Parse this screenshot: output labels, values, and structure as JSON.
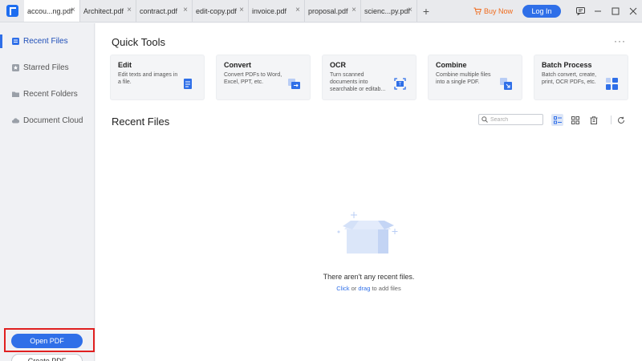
{
  "tabs": [
    {
      "label": "accou...ng.pdf",
      "active": true
    },
    {
      "label": "Architect.pdf"
    },
    {
      "label": "contract.pdf"
    },
    {
      "label": "edit-copy.pdf"
    },
    {
      "label": "invoice.pdf"
    },
    {
      "label": "proposal.pdf"
    },
    {
      "label": "scienc...py.pdf"
    }
  ],
  "tab_add": "+",
  "tab_close": "×",
  "header": {
    "buy_now": "Buy Now",
    "login": "Log In"
  },
  "sidebar": {
    "items": [
      {
        "label": "Recent Files",
        "icon": "recent-files-icon",
        "active": true
      },
      {
        "label": "Starred Files",
        "icon": "star-icon"
      },
      {
        "label": "Recent Folders",
        "icon": "folder-icon"
      },
      {
        "label": "Document Cloud",
        "icon": "cloud-icon"
      }
    ],
    "open_pdf": "Open PDF",
    "create_pdf": "Create PDF"
  },
  "main": {
    "quick_tools_title": "Quick Tools",
    "more": "···",
    "tools": [
      {
        "name": "Edit",
        "desc": "Edit texts and images in a file.",
        "icon": "edit-icon"
      },
      {
        "name": "Convert",
        "desc": "Convert PDFs to Word, Excel, PPT, etc.",
        "icon": "convert-icon"
      },
      {
        "name": "OCR",
        "desc": "Turn scanned documents into searchable or editab...",
        "icon": "ocr-icon"
      },
      {
        "name": "Combine",
        "desc": "Combine multiple files into a single PDF.",
        "icon": "combine-icon"
      },
      {
        "name": "Batch Process",
        "desc": "Batch convert, create, print, OCR PDFs, etc.",
        "icon": "batch-icon"
      }
    ],
    "recent_files_title": "Recent Files",
    "search_placeholder": "Search",
    "empty_text": "There aren't any recent files.",
    "empty_click": "Click",
    "empty_or": " or ",
    "empty_drag": "drag",
    "empty_suffix": " to add files"
  },
  "colors": {
    "accent": "#2f6fe8",
    "buy_now": "#f06a1b",
    "highlight": "#e02020"
  }
}
